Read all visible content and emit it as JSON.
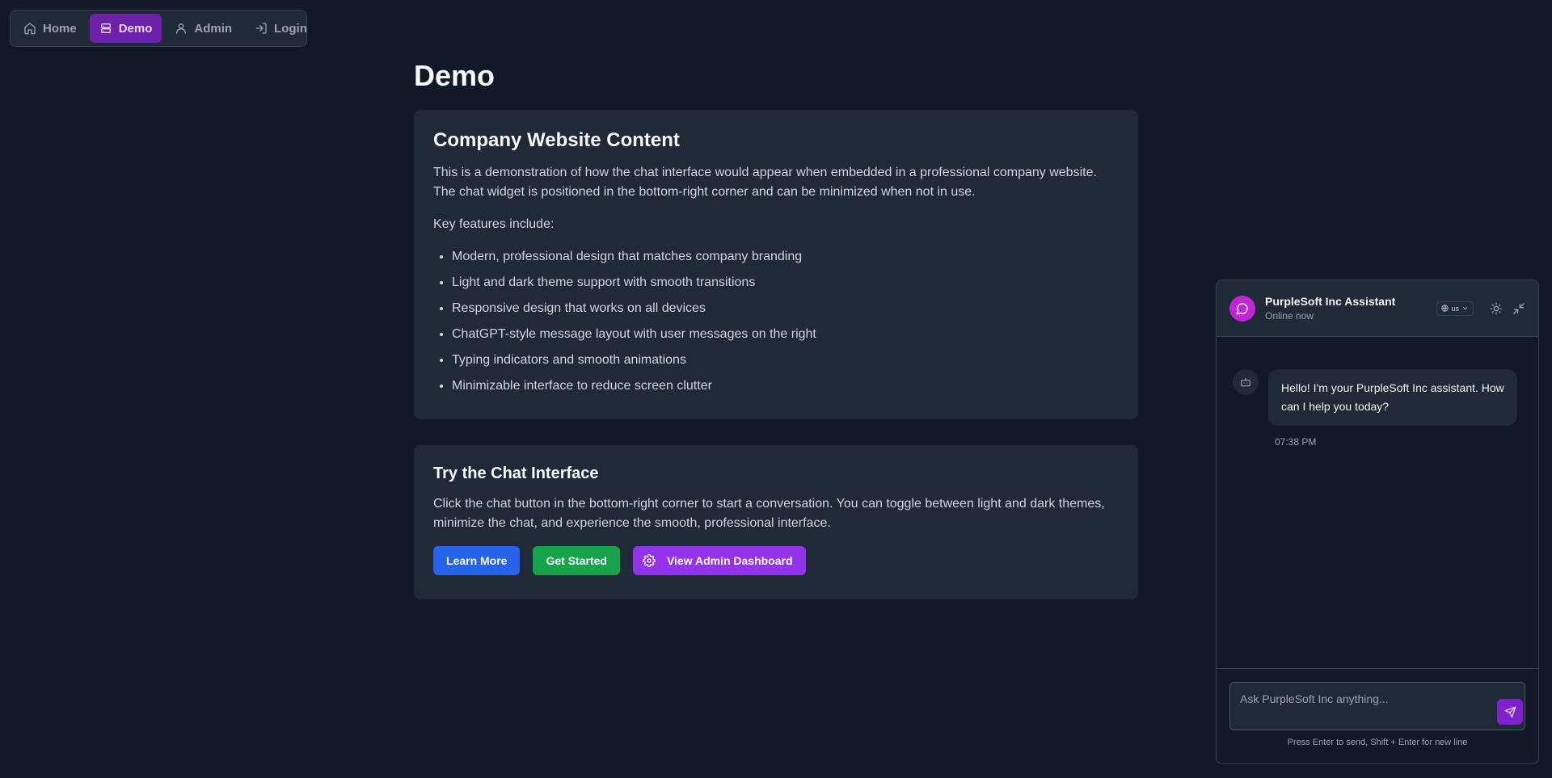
{
  "nav": {
    "items": [
      {
        "label": "Home",
        "icon": "home-icon"
      },
      {
        "label": "Demo",
        "icon": "bot-icon",
        "active": true
      },
      {
        "label": "Admin",
        "icon": "user-icon"
      },
      {
        "label": "Login",
        "icon": "login-icon"
      }
    ]
  },
  "page": {
    "title": "Demo"
  },
  "card1": {
    "title": "Company Website Content",
    "intro": "This is a demonstration of how the chat interface would appear when embedded in a professional company website. The chat widget is positioned in the bottom-right corner and can be minimized when not in use.",
    "features_label": "Key features include:",
    "features": [
      "Modern, professional design that matches company branding",
      "Light and dark theme support with smooth transitions",
      "Responsive design that works on all devices",
      "ChatGPT-style message layout with user messages on the right",
      "Typing indicators and smooth animations",
      "Minimizable interface to reduce screen clutter"
    ]
  },
  "card2": {
    "title": "Try the Chat Interface",
    "text": "Click the chat button in the bottom-right corner to start a conversation. You can toggle between light and dark themes, minimize the chat, and experience the smooth, professional interface.",
    "buttons": {
      "learn_more": "Learn More",
      "get_started": "Get Started",
      "admin_dashboard": "View Admin Dashboard"
    }
  },
  "chat": {
    "title": "PurpleSoft Inc Assistant",
    "status": "Online now",
    "language": "us",
    "messages": [
      {
        "text": "Hello! I'm your PurpleSoft Inc assistant. How can I help you today?",
        "time": "07:38 PM"
      }
    ],
    "input_placeholder": "Ask PurpleSoft Inc anything...",
    "hint": "Press Enter to send, Shift + Enter for new line"
  },
  "colors": {
    "background": "#111827",
    "card": "#1f2937",
    "accent_purple": "#9333ea",
    "blue": "#2563eb",
    "green": "#16a34a"
  }
}
